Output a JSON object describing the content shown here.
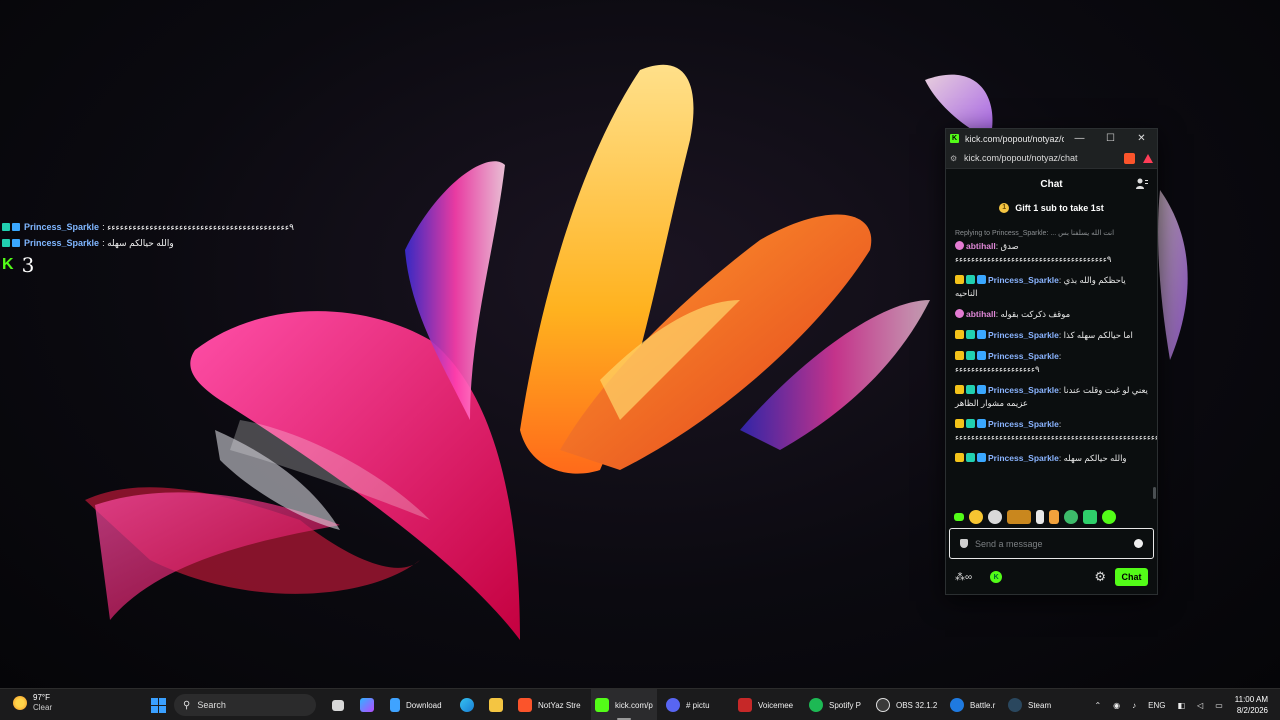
{
  "overlay": {
    "lines": [
      {
        "name": "Princess_Sparkle",
        "text": ": ٩ءءءءءءءءءءءءءءءءءءءءءءءءءءءءءءءءءءءءءءءءءءء"
      },
      {
        "name": "Princess_Sparkle",
        "text": ": والله حيالكم سهله"
      }
    ],
    "viewer_count": "3"
  },
  "window": {
    "title": "kick.com/popout/notyaz/ch...",
    "url": "kick.com/popout/notyaz/chat",
    "minimize_icon": "—",
    "maximize_icon": "☐",
    "close_icon": "✕"
  },
  "chat": {
    "header_title": "Chat",
    "gift_text": "Gift 1 sub to take 1st",
    "reply_text": "Replying to Princess_Sparkle: ... انت الله يسلفنا بس",
    "messages": [
      {
        "name": "abtihall",
        "color": "purple",
        "badges": [
          "ab"
        ],
        "text": "صدق",
        "extra": "٩ءءءءءءءءءءءءءءءءءءءءءءءءءءءءءءءءءءءءءء"
      },
      {
        "name": "Princess_Sparkle",
        "color": "blue",
        "badges": [
          "crown",
          "sub",
          "tool"
        ],
        "text": "ياحظكم والله بذي الناحيه"
      },
      {
        "name": "abtihall",
        "color": "purple",
        "badges": [
          "ab"
        ],
        "text": "موقف ذكركت بقوله"
      },
      {
        "name": "Princess_Sparkle",
        "color": "blue",
        "badges": [
          "crown",
          "sub",
          "tool"
        ],
        "text": "اما حيالكم سهله كذا"
      },
      {
        "name": "Princess_Sparkle",
        "color": "blue",
        "badges": [
          "crown",
          "sub",
          "tool"
        ],
        "text": "٩ءءءءءءءءءءءءءءءءءءءء"
      },
      {
        "name": "Princess_Sparkle",
        "color": "blue",
        "badges": [
          "crown",
          "sub",
          "tool"
        ],
        "text": "يعني لو غبت وقلت عندنا عزيمه مشوار الظاهر"
      },
      {
        "name": "Princess_Sparkle",
        "color": "blue",
        "badges": [
          "crown",
          "sub",
          "tool"
        ],
        "text": "٩ءءءءءءءءءءءءءءءءءءءءءءءءءءءءءءءءءءءءءءءءءءءءءءءءءءءءء"
      },
      {
        "name": "Princess_Sparkle",
        "color": "blue",
        "badges": [
          "crown",
          "sub",
          "tool"
        ],
        "text": "والله حيالكم سهله"
      }
    ],
    "input_placeholder": "Send a message",
    "infinite_label": "∞",
    "send_label": "Chat"
  },
  "taskbar": {
    "weather_temp": "97°F",
    "weather_cond": "Clear",
    "search_label": "Search",
    "items": [
      {
        "label": "Download",
        "color": "#3fa3ff"
      },
      {
        "label": "NotYaz Stre",
        "color": "#fb542b"
      },
      {
        "label": "kick.com/p",
        "color": "#53fc18"
      },
      {
        "label": "# pictu",
        "color": "#5865f2"
      },
      {
        "label": "Voicemee",
        "color": "#c62828"
      },
      {
        "label": "Spotify P",
        "color": "#1db954"
      },
      {
        "label": "OBS 32.1.2",
        "color": "#444444"
      },
      {
        "label": "Battle.r",
        "color": "#1f7ae0"
      },
      {
        "label": "Steam",
        "color": "#2a475e"
      }
    ],
    "language": "ENG",
    "time": "11:00 AM",
    "date": "8/2/2026"
  },
  "colors": {
    "kick_green": "#53fc18",
    "name_blue": "#8ab4ff",
    "name_purple": "#e088d8"
  }
}
